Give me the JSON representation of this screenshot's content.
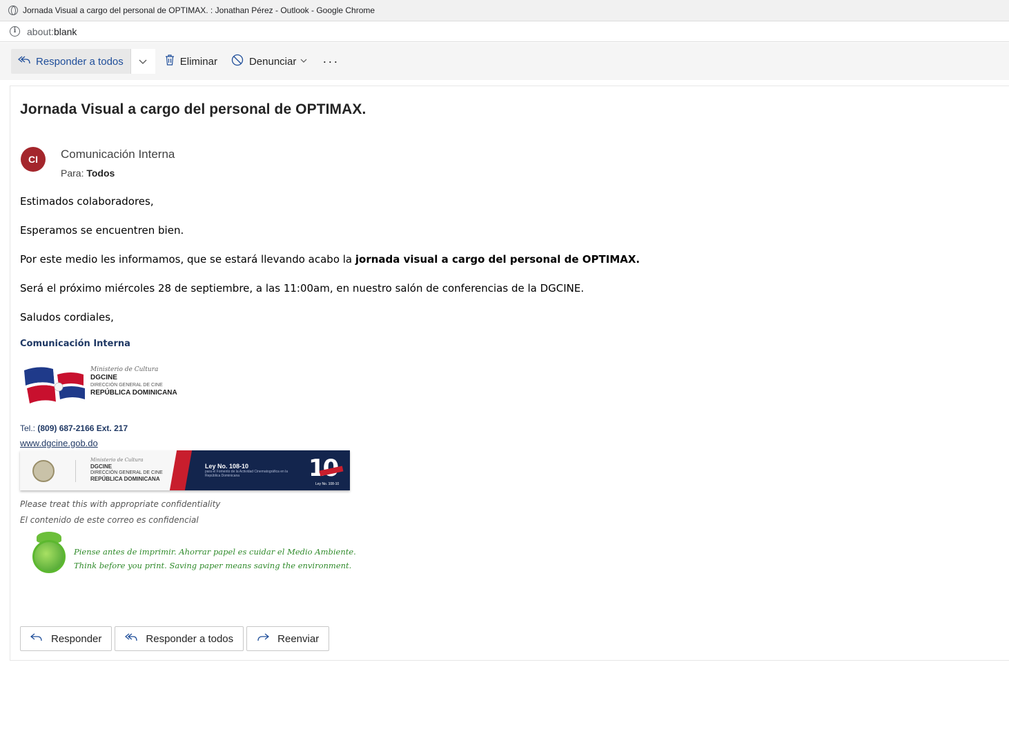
{
  "browser": {
    "window_title": "Jornada Visual a cargo del personal de OPTIMAX. : Jonathan Pérez - Outlook - Google Chrome",
    "address_prefix": "about:",
    "address_rest": "blank"
  },
  "toolbar": {
    "reply_all_label": "Responder a todos",
    "delete_label": "Eliminar",
    "report_label": "Denunciar",
    "more_label": "···"
  },
  "email": {
    "subject": "Jornada Visual a cargo del personal de OPTIMAX.",
    "avatar_initials": "CI",
    "sender": "Comunicación Interna",
    "to_prefix": "Para:",
    "to_value": "Todos",
    "greeting": "Estimados colaboradores,",
    "line1": "Esperamos se encuentren bien.",
    "line2_prefix": "Por este medio les informamos, que se estará llevando acabo la ",
    "line2_bold": "jornada visual a cargo del personal de OPTIMAX.",
    "line3": "Será el próximo miércoles 28 de septiembre, a las 11:00am, en nuestro salón de conferencias de la DGCINE.",
    "closing": "Saludos cordiales,"
  },
  "signature": {
    "name": "Comunicación Interna",
    "logo_ministry": "Ministerio de Cultura",
    "logo_org": "DGCINE",
    "logo_org_full": "DIRECCIÓN GENERAL DE CINE",
    "logo_country": "REPÚBLICA DOMINICANA",
    "tel_prefix": "Tel.:",
    "tel_value": "(809) 687-2166 Ext. 217",
    "website": "www.dgcine.gob.do",
    "banner_law": "Ley No. 108-10",
    "banner_law_sub": "para el Fomento de la Actividad Cinematográfica en la República Dominicana",
    "banner_ten": "10",
    "banner_ten_label": "Ley No. 108-10",
    "confidential_en": "Please treat this with appropriate confidentiality",
    "confidential_es": "El contenido de este correo es confidencial",
    "eco_es": "Piense antes de imprimir. Ahorrar papel es cuidar el Medio Ambiente.",
    "eco_en": "Think before you print. Saving paper means saving the environment."
  },
  "actions": {
    "reply": "Responder",
    "reply_all": "Responder a todos",
    "forward": "Reenviar"
  },
  "colors": {
    "accent": "#1f4e9a",
    "avatar": "#a4262c",
    "signature": "#1f3864",
    "eco": "#2f8a2a"
  },
  "icons": [
    "globe-icon",
    "info-icon",
    "reply-all-icon",
    "chevron-down-icon",
    "trash-icon",
    "block-icon",
    "more-icon",
    "reply-icon",
    "forward-icon",
    "flag-logo",
    "seal-logo",
    "eco-globe-icon"
  ]
}
